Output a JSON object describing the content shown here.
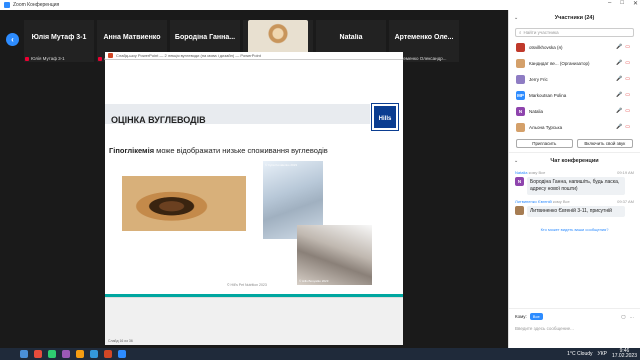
{
  "window": {
    "title": "Zoom Конференция"
  },
  "participants_strip": [
    {
      "name": "Юлія Мутаф 3-1",
      "label": "Юлія Мутаф 3-1"
    },
    {
      "name": "Анна Матвиенко",
      "label": "Анна Матвиенко"
    },
    {
      "name": "Бородіна Ганна...",
      "label": "Бородіна Ганна 3-1"
    },
    {
      "name": "",
      "label": "Оксана Кальна"
    },
    {
      "name": "Natalia",
      "label": "Natalia"
    },
    {
      "name": "Артеменко Оле...",
      "label": "Артеменко Олександр..."
    }
  ],
  "ppt": {
    "title": "Слайд-шоу PowerPoint — 2 лекція вуглеводи (на мова і дизайн) — PowerPoint",
    "status": "Слайд 16 из 36"
  },
  "slide": {
    "title": "ОЦІНКА ВУГЛЕВОДІВ",
    "logo": "Hills",
    "subtitle_bold": "Гіпоглікемія",
    "subtitle_rest": " може відображати низьке споживання вуглеводів",
    "cap1": "© Hills Pet Nutrition 2023",
    "cap2": "© Iryna Kovalenko 2023",
    "cap3": "© Hills Bosyatko 2023",
    "copyright": "© Hill's Pet Nutrition 2023"
  },
  "panel": {
    "participants_title": "Участники (24)",
    "search_placeholder": "Найти участника",
    "participants": [
      {
        "initials": "",
        "name": "otsvilkhovska (я)",
        "color": "#c0392b"
      },
      {
        "initials": "",
        "name": "Кандидат ве... (Организатор)",
        "color": "#d4a06a"
      },
      {
        "initials": "",
        "name": "Jerry Fric",
        "color": "#8e7cc3"
      },
      {
        "initials": "MP",
        "name": "Markoutsan Polina",
        "color": "#2d8cff"
      },
      {
        "initials": "N",
        "name": "Natalia",
        "color": "#8e44ad"
      },
      {
        "initials": "",
        "name": "Альона Турська",
        "color": "#d4a06a"
      }
    ],
    "invite_button": "Пригласить",
    "unmute_button": "Включить свой звук",
    "chat_title": "Чат конференции",
    "messages": [
      {
        "from": "Natalia",
        "to": "кому Все",
        "time": "09:19 AM",
        "initial": "N",
        "color": "#8e44ad",
        "text": "Бородіна Ганна, напишіть, будь ласка, адресу нової пошти)"
      },
      {
        "from": "Литвиненко Євгеній",
        "to": "кому Все",
        "time": "09:37 AM",
        "initial": "",
        "color": "#a67c52",
        "text": "Литвиненко Євгеній 3-11, присутній"
      }
    ],
    "who_can_see": "Кто может видеть ваши сообщения?",
    "to_label": "Кому:",
    "to_value": "Все",
    "input_placeholder": "Введите здесь сообщение..."
  },
  "taskbar": {
    "weather": "1°C  Cloudy",
    "lang": "УКР",
    "time": "9:46",
    "date": "17.02.2023"
  }
}
